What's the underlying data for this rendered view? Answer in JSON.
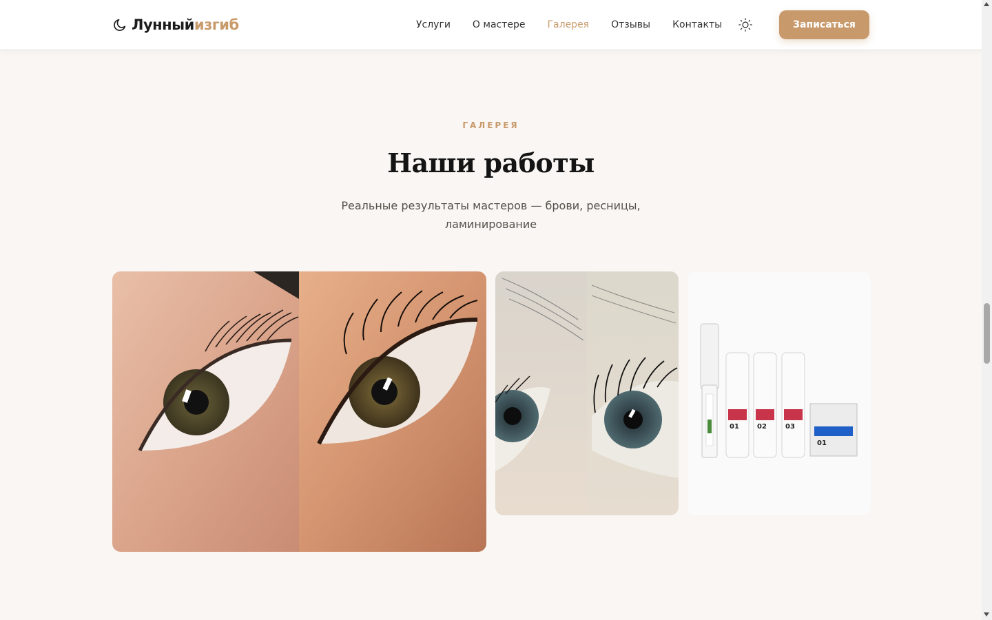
{
  "header": {
    "logo": {
      "primary": "Лунный",
      "accent": "изгиб"
    },
    "nav": [
      {
        "label": "Услуги",
        "active": false
      },
      {
        "label": "О мастере",
        "active": false
      },
      {
        "label": "Галерея",
        "active": true
      },
      {
        "label": "Отзывы",
        "active": false
      },
      {
        "label": "Контакты",
        "active": false
      }
    ],
    "theme_icon": "sun-icon",
    "cta_label": "Записаться"
  },
  "gallery": {
    "eyebrow": "ГАЛЕРЕЯ",
    "title": "Наши работы",
    "subtitle_line1": "Реальные результаты мастеров — брови, ресницы,",
    "subtitle_line2": "ламинирование",
    "items": [
      {
        "kind": "lash-before-after-photo"
      },
      {
        "kind": "lash-before-after-closeup-photo"
      },
      {
        "kind": "lamination-products-photo",
        "labels": {
          "n1": "01",
          "n2": "02",
          "n3": "03",
          "sachet": "01"
        }
      }
    ]
  },
  "colors": {
    "accent": "#c89a6a",
    "background": "#f9f6f3",
    "header_bg": "#ffffff",
    "text": "#1c1c1c"
  }
}
